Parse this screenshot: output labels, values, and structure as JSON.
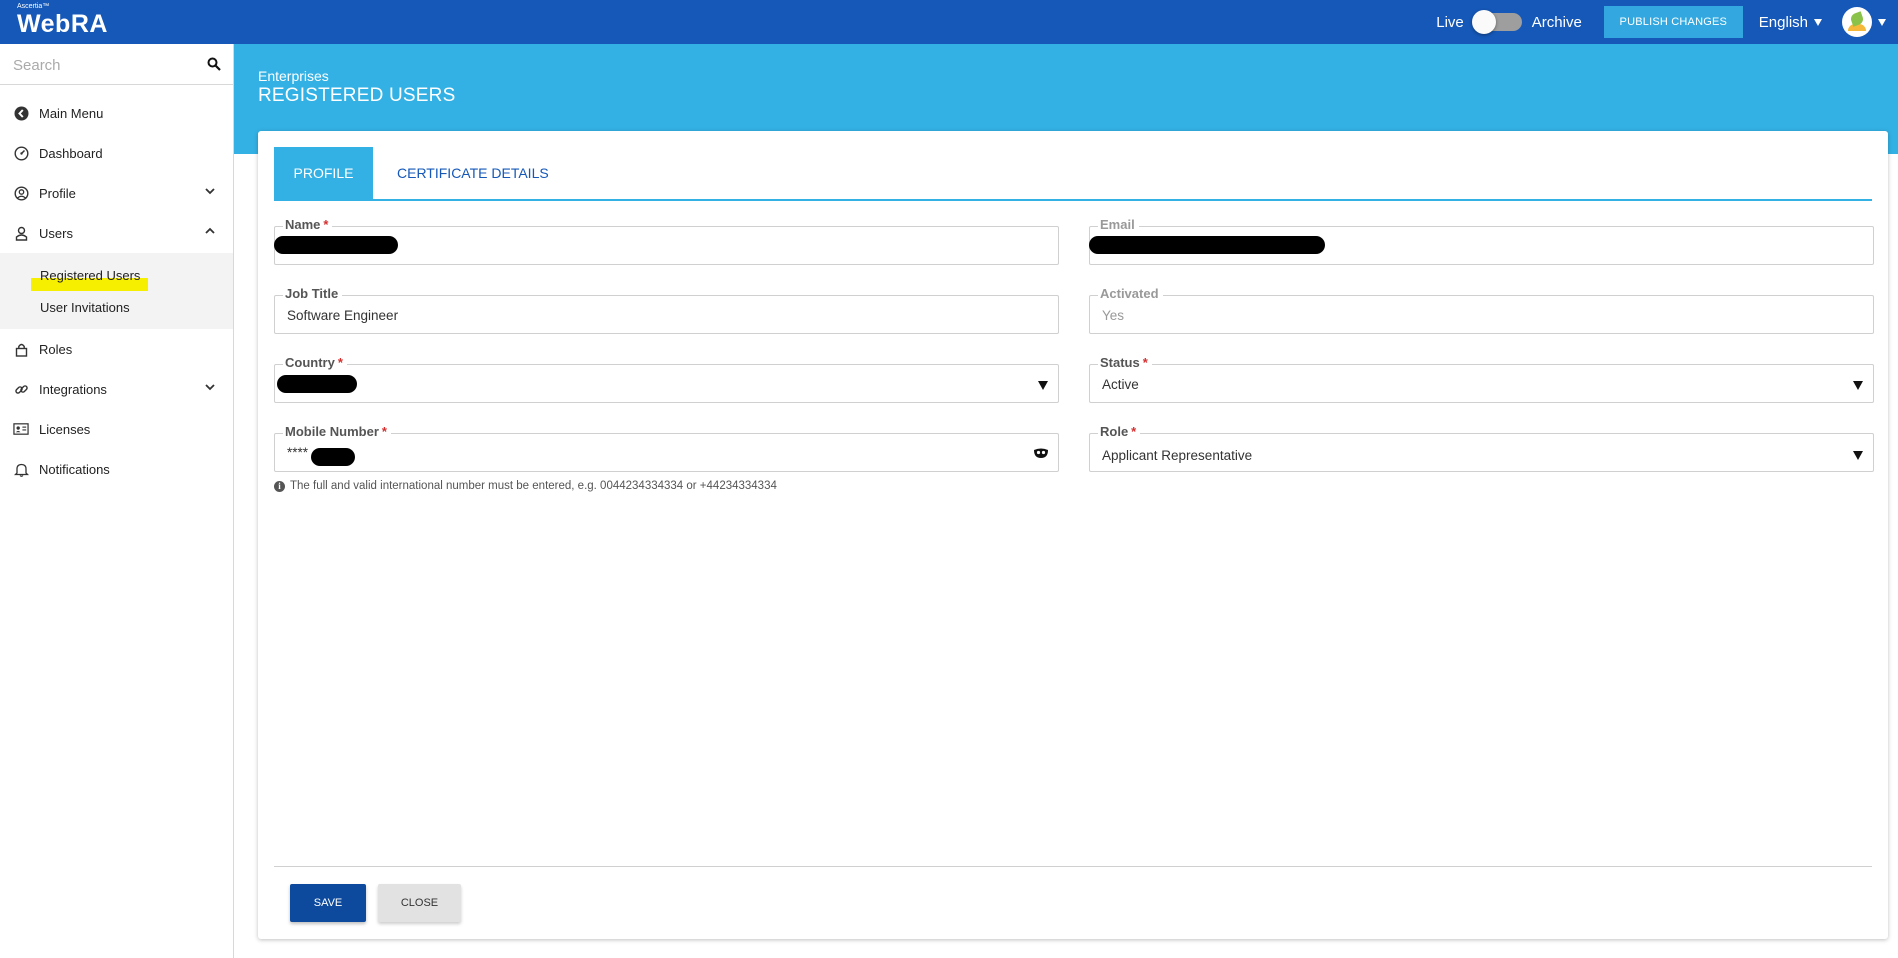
{
  "brand": {
    "small": "Ascertia™",
    "name": "WebRA"
  },
  "header": {
    "live_label": "Live",
    "archive_label": "Archive",
    "publish_label": "PUBLISH CHANGES",
    "language": "English"
  },
  "sidebar": {
    "search_placeholder": "Search",
    "items": {
      "main_menu": "Main Menu",
      "dashboard": "Dashboard",
      "profile": "Profile",
      "users": "Users",
      "registered_users": "Registered Users",
      "user_invitations": "User Invitations",
      "roles": "Roles",
      "integrations": "Integrations",
      "licenses": "Licenses",
      "notifications": "Notifications"
    }
  },
  "page": {
    "breadcrumb": "Enterprises",
    "title": "REGISTERED USERS",
    "tabs": {
      "profile": "PROFILE",
      "certificate_details": "CERTIFICATE DETAILS"
    }
  },
  "form": {
    "name": {
      "label": "Name",
      "value": ""
    },
    "email": {
      "label": "Email",
      "value": ""
    },
    "job_title": {
      "label": "Job Title",
      "value": "Software Engineer"
    },
    "activated": {
      "label": "Activated",
      "value": "Yes"
    },
    "country": {
      "label": "Country",
      "value": ""
    },
    "status": {
      "label": "Status",
      "value": "Active"
    },
    "mobile": {
      "label": "Mobile Number",
      "value": "****"
    },
    "role": {
      "label": "Role",
      "value": "Applicant Representative"
    },
    "hint": "The full and valid international number must be entered, e.g. 0044234334334 or +44234334334",
    "required_mark": "*"
  },
  "actions": {
    "save": "SAVE",
    "close": "CLOSE"
  },
  "colors": {
    "topbar": "#1558b8",
    "banner": "#33b1e4",
    "save": "#0d4a9e",
    "highlight": "#f7ef00"
  }
}
